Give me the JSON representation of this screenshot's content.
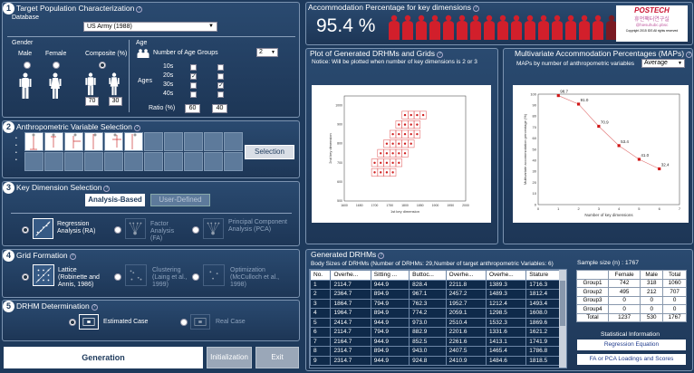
{
  "s1": {
    "num": "1",
    "title": "Target Population Characterization",
    "database_label": "Database",
    "database_value": "US Army (1988)",
    "gender_label": "Gender",
    "male": "Male",
    "female": "Female",
    "composite": "Composite (%)",
    "comp_male": "70",
    "comp_female": "30",
    "age_label": "Age",
    "num_groups_label": "Number of Age Groups",
    "num_groups_value": "2",
    "ages_label": "Ages",
    "age_rows": [
      "10s",
      "20s",
      "30s",
      "40s"
    ],
    "ratio_label": "Ratio (%)",
    "ratio1": "60",
    "ratio2": "40"
  },
  "s2": {
    "num": "2",
    "title": "Anthropometric Variable Selection",
    "selection_button": "Selection"
  },
  "s3": {
    "num": "3",
    "title": "Key Dimension Selection",
    "tab_analysis": "Analysis-Based",
    "tab_user": "User-Defined",
    "opt_regression": "Regression Analysis (RA)",
    "opt_factor": "Factor Analysis (FA)",
    "opt_pca": "Principal Component Analysis (PCA)"
  },
  "s4": {
    "num": "4",
    "title": "Grid Formation",
    "opt_lattice": "Lattice (Robinette and Annis, 1986)",
    "opt_clustering": "Clustering (Laing et al., 1999)",
    "opt_optimization": "Optimization (McCulloch et al., 1998)"
  },
  "s5": {
    "num": "5",
    "title": "DRHM Determination",
    "opt_estimated": "Estimated Case",
    "opt_real": "Real Case"
  },
  "buttons": {
    "generation": "Generation",
    "initialization": "Initialization",
    "exit": "Exit"
  },
  "accom": {
    "title": "Accommodation Percentage for key dimensions",
    "percent": "95.4 %",
    "figures_total": 17,
    "figures_highlighted": 16
  },
  "logo": {
    "name": "POSTECH",
    "sub": "휴먼팩터연구실",
    "sub2": "@hiesuhubc.pbsc",
    "copyright": "Copyright 2015 IDS All rights reserved"
  },
  "plot1": {
    "title": "Plot of Generated DRHMs and Grids",
    "notice": "Notice: Will be plotted when number of key dimensions is 2 or 3"
  },
  "plot2": {
    "title": "Multivariate Accommodation Percentages (MAPs)",
    "subtitle": "MAPs by number of anthropometric variables",
    "dropdown": "Average"
  },
  "chart_data": [
    {
      "type": "scatter",
      "xlabel": "1st key dimension",
      "ylabel": "2nd key dimension",
      "xlim": [
        1600,
        2000
      ],
      "ylim": [
        500,
        1050
      ],
      "xticks": [
        "1600",
        "1650",
        "1700",
        "1750",
        "1800",
        "1850",
        "1900",
        "1950",
        "2000"
      ],
      "yticks": [
        "500",
        "600",
        "700",
        "800",
        "900",
        "1000"
      ],
      "series": [
        {
          "x": [
            1700,
            1720,
            1740,
            1760,
            1700,
            1720,
            1740,
            1760,
            1780,
            1720,
            1740,
            1760,
            1780,
            1800,
            1740,
            1760,
            1780,
            1800,
            1820,
            1760,
            1780,
            1800,
            1820,
            1840,
            1780,
            1800,
            1820,
            1840,
            1800,
            1820,
            1840,
            1860
          ],
          "y": [
            650,
            650,
            650,
            650,
            700,
            700,
            700,
            700,
            700,
            750,
            750,
            750,
            750,
            750,
            800,
            800,
            800,
            800,
            800,
            850,
            850,
            850,
            850,
            850,
            900,
            900,
            900,
            900,
            950,
            950,
            950,
            950
          ]
        }
      ]
    },
    {
      "type": "line",
      "xlabel": "Number of key dimensions",
      "ylabel": "Multivariate accommodation percentage (%)",
      "xlim": [
        0,
        7
      ],
      "ylim": [
        0,
        100
      ],
      "x": [
        1,
        2,
        3,
        4,
        5,
        6
      ],
      "values": [
        98.7,
        91.0,
        70.9,
        53.4,
        41.0,
        32.4
      ],
      "labels": [
        "98.7",
        "91.0",
        "70.9",
        "53.4",
        "41.0",
        "32.4"
      ]
    }
  ],
  "drhm": {
    "title": "Generated DRHMs",
    "body_sizes_label": "Body Sizes of DRHMs (Number of DRHMs: 29,",
    "target_label": "Number of target anthropometric Variables: 6)",
    "columns": [
      "No.",
      "Overhe...",
      "Sitting ...",
      "Buttoc...",
      "Overhe...",
      "Overhe...",
      "Stature"
    ],
    "rows": [
      [
        "1",
        "2114.7",
        "944.9",
        "828.4",
        "2211.8",
        "1389.3",
        "1716.3"
      ],
      [
        "2",
        "2364.7",
        "894.9",
        "967.1",
        "2457.2",
        "1489.3",
        "1812.4"
      ],
      [
        "3",
        "1864.7",
        "794.9",
        "762.3",
        "1952.7",
        "1212.4",
        "1493.4"
      ],
      [
        "4",
        "1964.7",
        "894.9",
        "774.2",
        "2059.1",
        "1298.5",
        "1608.0"
      ],
      [
        "5",
        "2414.7",
        "944.9",
        "973.0",
        "2510.4",
        "1532.3",
        "1869.6"
      ],
      [
        "6",
        "2114.7",
        "794.9",
        "882.9",
        "2201.6",
        "1331.6",
        "1621.2"
      ],
      [
        "7",
        "2164.7",
        "944.9",
        "852.5",
        "2261.6",
        "1413.1",
        "1741.9"
      ],
      [
        "8",
        "2314.7",
        "894.9",
        "943.0",
        "2407.5",
        "1465.4",
        "1786.8"
      ],
      [
        "9",
        "2314.7",
        "944.9",
        "924.8",
        "2410.9",
        "1484.6",
        "1818.5"
      ]
    ]
  },
  "sample": {
    "label": "Sample size (n) : 1767",
    "columns": [
      "",
      "Female",
      "Male",
      "Total"
    ],
    "rows": [
      [
        "Group1",
        "742",
        "318",
        "1060"
      ],
      [
        "Group2",
        "495",
        "212",
        "707"
      ],
      [
        "Group3",
        "0",
        "0",
        "0"
      ],
      [
        "Group4",
        "0",
        "0",
        "0"
      ],
      [
        "Total",
        "1237",
        "530",
        "1767"
      ]
    ]
  },
  "stats": {
    "title": "Statistical Information",
    "regression": "Regression Equation",
    "fa_pca": "FA or PCA Loadings and Scores"
  }
}
